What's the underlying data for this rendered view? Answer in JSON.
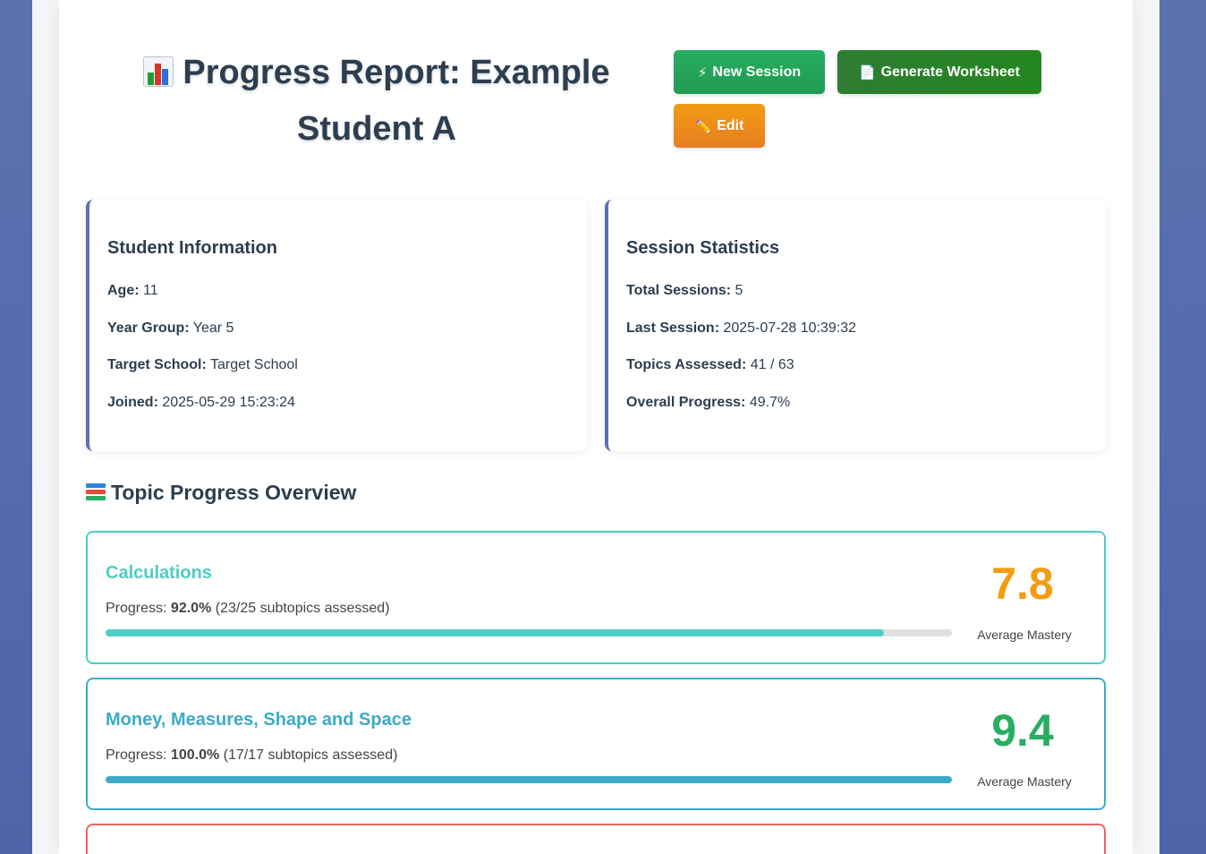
{
  "header": {
    "title": "Progress Report: Example Student A",
    "buttons": {
      "new_session": "New Session",
      "generate_worksheet": "Generate Worksheet",
      "edit": "Edit"
    },
    "icons": {
      "title": "bar-chart-icon",
      "new_session": "lightning-icon",
      "generate_worksheet": "document-icon",
      "edit": "pencil-icon"
    }
  },
  "student_info": {
    "heading": "Student Information",
    "rows": [
      {
        "label": "Age:",
        "value": "11"
      },
      {
        "label": "Year Group:",
        "value": "Year 5"
      },
      {
        "label": "Target School:",
        "value": "Target School"
      },
      {
        "label": "Joined:",
        "value": "2025-05-29 15:23:24"
      }
    ]
  },
  "session_stats": {
    "heading": "Session Statistics",
    "rows": [
      {
        "label": "Total Sessions:",
        "value": "5"
      },
      {
        "label": "Last Session:",
        "value": "2025-07-28 10:39:32"
      },
      {
        "label": "Topics Assessed:",
        "value": "41 / 63"
      },
      {
        "label": "Overall Progress:",
        "value": "49.7%"
      }
    ]
  },
  "topics_section": {
    "title": "Topic Progress Overview",
    "icon": "books-icon",
    "topics": [
      {
        "name": "Calculations",
        "progress_prefix": "Progress:",
        "progress_pct": "92.0%",
        "progress_detail": "(23/25 subtopics assessed)",
        "progress_fraction": 0.92,
        "mastery": "7.8",
        "mastery_label": "Average Mastery",
        "color": "#4ecdc4",
        "mastery_color": "#f39c12"
      },
      {
        "name": "Money, Measures, Shape and Space",
        "progress_prefix": "Progress:",
        "progress_pct": "100.0%",
        "progress_detail": "(17/17 subtopics assessed)",
        "progress_fraction": 1.0,
        "mastery": "9.4",
        "mastery_label": "Average Mastery",
        "color": "#3aabc9",
        "mastery_color": "#27ae60"
      },
      {
        "color": "#ef6461"
      }
    ]
  },
  "colors": {
    "background": "#5b72b0",
    "accent_border": "#5b72b0",
    "new_session_button": "#27ae60",
    "generate_worksheet_button": "#2e7d32",
    "edit_button": "#f39c12"
  }
}
